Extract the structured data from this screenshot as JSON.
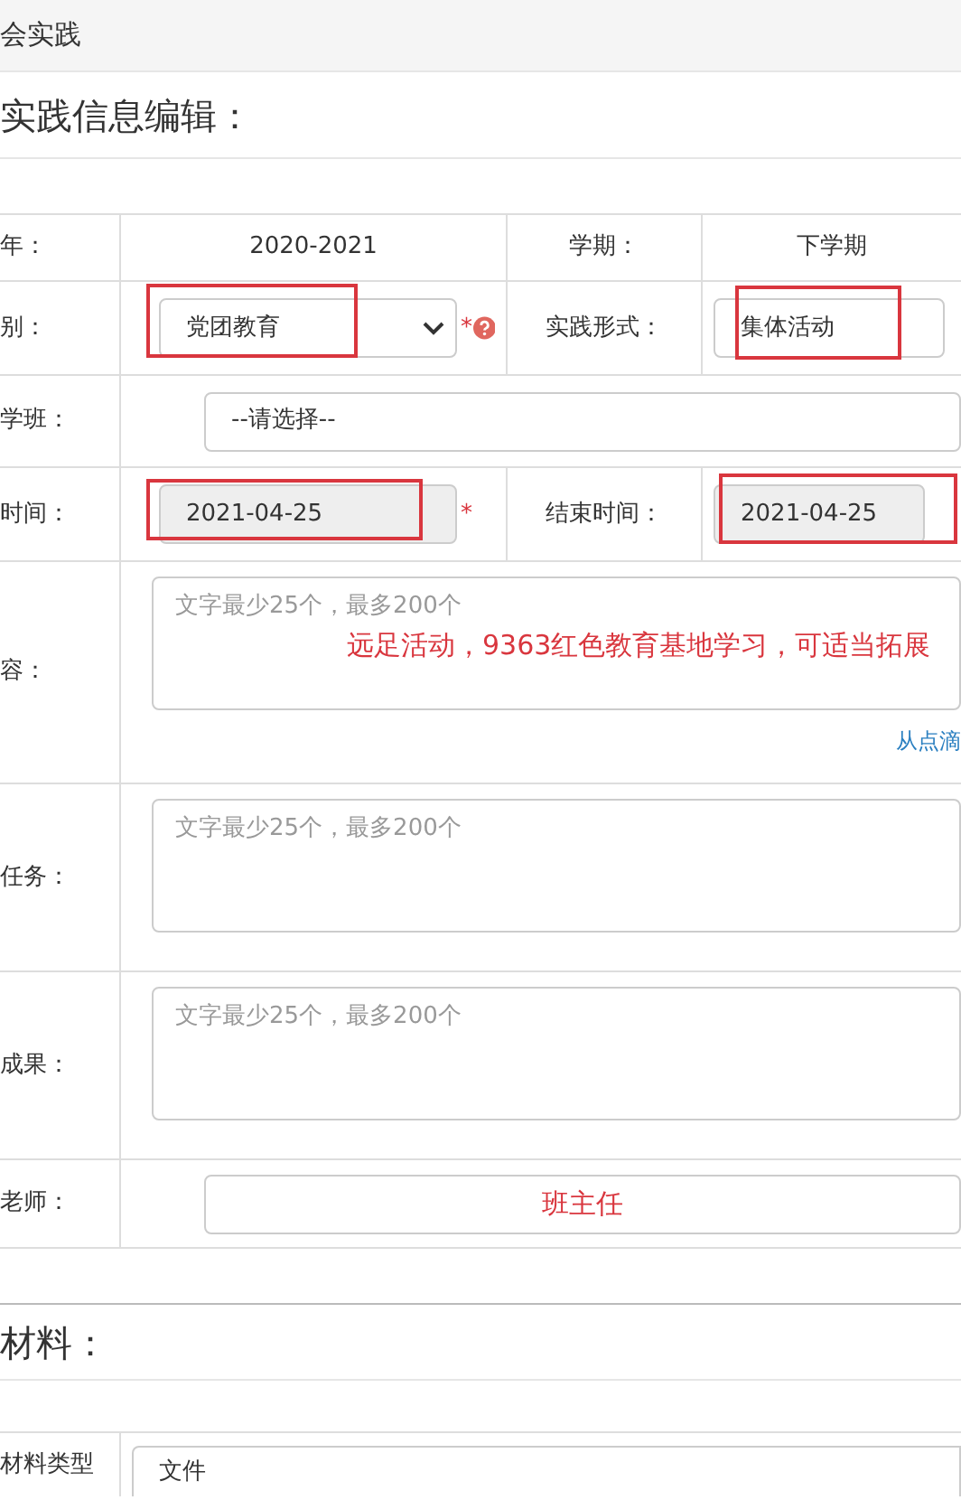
{
  "breadcrumb": "会实践",
  "section_title": "实践信息编辑：",
  "rows": [
    {
      "kind": "pair",
      "cells": [
        {
          "kind": "label",
          "text": "年："
        },
        {
          "kind": "text",
          "text": "2020-2021"
        },
        {
          "kind": "label",
          "text": "学期："
        },
        {
          "kind": "text",
          "text": "下学期"
        }
      ]
    },
    {
      "kind": "pair",
      "cells": [
        {
          "kind": "label",
          "text": "别："
        },
        {
          "kind": "select",
          "value": "党团教育",
          "required_mark": "*",
          "help": true,
          "annotated": true
        },
        {
          "kind": "label",
          "text": "实践形式："
        },
        {
          "kind": "input",
          "value": "集体活动",
          "annotated": true
        }
      ]
    },
    {
      "kind": "wide",
      "cells": [
        {
          "kind": "label",
          "text": "学班："
        },
        {
          "kind": "select",
          "value": "--请选择--"
        }
      ]
    },
    {
      "kind": "pair",
      "cells": [
        {
          "kind": "label",
          "text": "时间："
        },
        {
          "kind": "date",
          "value": "2021-04-25",
          "required_mark": "*",
          "annotated": true
        },
        {
          "kind": "label",
          "text": "结束时间："
        },
        {
          "kind": "date",
          "value": "2021-04-25",
          "annotated": true
        }
      ]
    },
    {
      "kind": "wide",
      "cells": [
        {
          "kind": "label",
          "text": "容："
        },
        {
          "kind": "textarea",
          "placeholder": "文字最少25个，最多200个",
          "note": "远足活动，9363红色教育基地学习，可适当拓展",
          "link": "从点滴"
        }
      ]
    },
    {
      "kind": "wide",
      "cells": [
        {
          "kind": "label",
          "text": "任务："
        },
        {
          "kind": "textarea",
          "placeholder": "文字最少25个，最多200个"
        }
      ]
    },
    {
      "kind": "wide",
      "cells": [
        {
          "kind": "label",
          "text": "成果："
        },
        {
          "kind": "textarea",
          "placeholder": "文字最少25个，最多200个"
        }
      ]
    },
    {
      "kind": "wide",
      "cells": [
        {
          "kind": "label",
          "text": "老师："
        },
        {
          "kind": "input",
          "note": "班主任"
        }
      ]
    }
  ],
  "materials": {
    "title": "材料：",
    "label": "材料类型",
    "value": "文件"
  }
}
